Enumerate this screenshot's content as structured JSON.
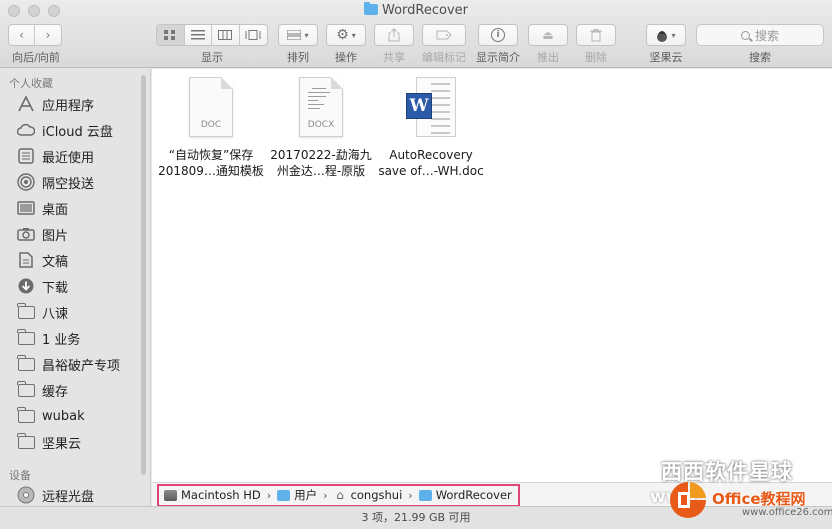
{
  "window": {
    "title": "WordRecover"
  },
  "toolbar": {
    "nav_label": "向后/向前",
    "view_label": "显示",
    "sort_label": "排列",
    "action_label": "操作",
    "share_label": "共享",
    "tags_label": "编辑标记",
    "info_label": "显示简介",
    "eject_label": "推出",
    "delete_label": "删除",
    "nutstore_label": "坚果云",
    "search_placeholder": "搜索",
    "search_label": "搜索"
  },
  "sidebar": {
    "favorites_header": "个人收藏",
    "favorites": [
      {
        "label": "应用程序",
        "icon": "applications-icon"
      },
      {
        "label": "iCloud 云盘",
        "icon": "cloud-icon"
      },
      {
        "label": "最近使用",
        "icon": "recents-icon"
      },
      {
        "label": "隔空投送",
        "icon": "airdrop-icon"
      },
      {
        "label": "桌面",
        "icon": "desktop-icon"
      },
      {
        "label": "图片",
        "icon": "camera-icon"
      },
      {
        "label": "文稿",
        "icon": "document-icon"
      },
      {
        "label": "下载",
        "icon": "download-icon"
      },
      {
        "label": "八谏",
        "icon": "folder-icon"
      },
      {
        "label": "1 业务",
        "icon": "folder-icon"
      },
      {
        "label": "昌裕破产专项",
        "icon": "folder-icon"
      },
      {
        "label": "缓存",
        "icon": "folder-icon"
      },
      {
        "label": "wubak",
        "icon": "folder-icon"
      },
      {
        "label": "坚果云",
        "icon": "folder-icon"
      }
    ],
    "devices_header": "设备",
    "devices": [
      {
        "label": "远程光盘",
        "icon": "disc-icon"
      }
    ]
  },
  "files": [
    {
      "line1": "“自动恢复”保存",
      "line2": "201809…通知模板",
      "ext": "DOC",
      "type": "doc"
    },
    {
      "line1": "20170222-勐海九",
      "line2": "州金达…程-原版",
      "ext": "DOCX",
      "type": "docx"
    },
    {
      "line1": "AutoRecovery",
      "line2": "save of…-WH.doc",
      "ext": "",
      "type": "word"
    }
  ],
  "pathbar": {
    "crumbs": [
      "Macintosh HD",
      "用户",
      "congshui",
      "WordRecover"
    ]
  },
  "status": {
    "text": "3 项，21.99 GB 可用"
  },
  "watermark": {
    "line1": "西西软件星球",
    "www": "www.",
    "office": "Office教程网",
    "url": "www.office26.com"
  }
}
